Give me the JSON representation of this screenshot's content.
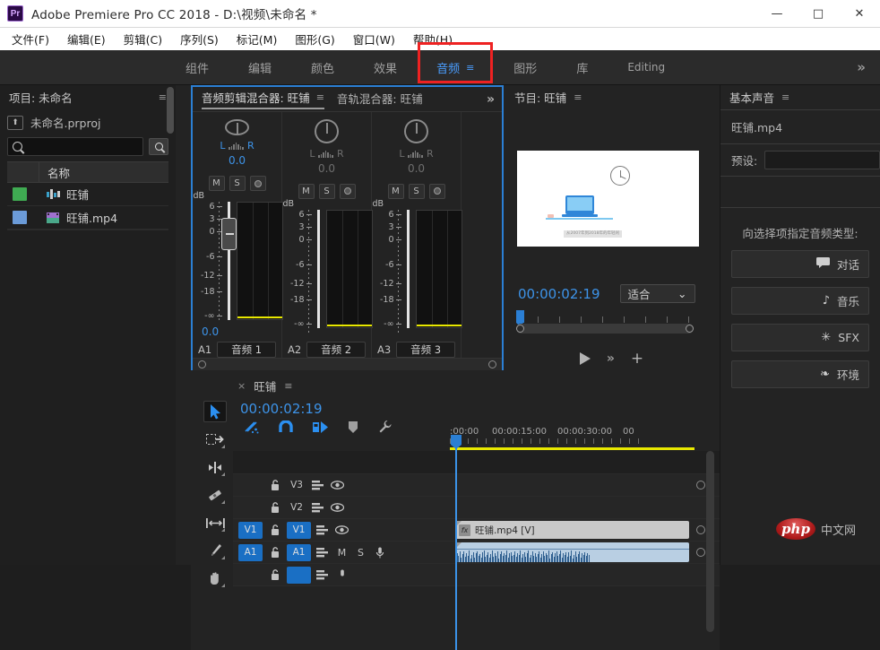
{
  "window": {
    "app_title": "Adobe Premiere Pro CC 2018 - D:\\视频\\未命名 *",
    "logo": "Pr",
    "minimize": "—",
    "maximize": "□",
    "close": "✕"
  },
  "menu": {
    "items": [
      "文件(F)",
      "编辑(E)",
      "剪辑(C)",
      "序列(S)",
      "标记(M)",
      "图形(G)",
      "窗口(W)",
      "帮助(H)"
    ]
  },
  "workspace": {
    "items": [
      {
        "label": "组件",
        "active": false
      },
      {
        "label": "编辑",
        "active": false
      },
      {
        "label": "颜色",
        "active": false
      },
      {
        "label": "效果",
        "active": false
      },
      {
        "label": "音频",
        "active": true
      },
      {
        "label": "图形",
        "active": false
      },
      {
        "label": "库",
        "active": false
      },
      {
        "label": "Editing",
        "active": false
      }
    ],
    "menu_glyph": "≡",
    "overflow": "»",
    "highlight_color": "#ee2222"
  },
  "project": {
    "title": "项目: 未命名",
    "menu_glyph": "≡",
    "file_name": "未命名.prproj",
    "search_placeholder": "",
    "column_header": "名称",
    "items": [
      {
        "label": "旺铺",
        "swatch": "#3fab52",
        "icon": "sequence-icon"
      },
      {
        "label": "旺铺.mp4",
        "swatch": "#6b9bd8",
        "icon": "video-clip-icon"
      }
    ]
  },
  "mixer": {
    "tabs": [
      {
        "label": "音频剪辑混合器: 旺铺",
        "active": true,
        "menu_glyph": "≡"
      },
      {
        "label": "音轨混合器: 旺铺",
        "active": false
      }
    ],
    "overflow": "»",
    "db_label": "dB",
    "db_ticks": [
      "6",
      "3",
      "0",
      "-6",
      "-12",
      "-18",
      "-∞"
    ],
    "strips": [
      {
        "pan_left": "L",
        "pan_right": "R",
        "pan_value": "0.0",
        "mute": "M",
        "solo": "S",
        "volume": "0.0",
        "track_id": "A1",
        "track_name": "音频 1",
        "selected": true
      },
      {
        "pan_left": "L",
        "pan_right": "R",
        "pan_value": "0.0",
        "mute": "M",
        "solo": "S",
        "volume": "",
        "track_id": "A2",
        "track_name": "音频 2",
        "selected": false
      },
      {
        "pan_left": "L",
        "pan_right": "R",
        "pan_value": "0.0",
        "mute": "M",
        "solo": "S",
        "volume": "",
        "track_id": "A3",
        "track_name": "音频 3",
        "selected": false
      }
    ]
  },
  "program": {
    "title": "节目: 旺铺",
    "menu_glyph": "≡",
    "timecode": "00:00:02:19",
    "fit_label": "适合",
    "fit_chevron": "⌄",
    "play_icon": "play-icon",
    "more_icon": "»",
    "add_icon": "+",
    "video_caption": "从2007年到2018年的年轻闲"
  },
  "essential": {
    "title": "基本声音",
    "menu_glyph": "≡",
    "clip_name": "旺铺.mp4",
    "preset_label": "预设:",
    "preset_value": "",
    "assign_label": "向选择项指定音频类型:",
    "types": [
      {
        "label": "对话",
        "icon": "speech-bubble-icon",
        "glyph": "💬"
      },
      {
        "label": "音乐",
        "icon": "music-note-icon",
        "glyph": "♪"
      },
      {
        "label": "SFX",
        "icon": "sparkle-icon",
        "glyph": "✳"
      },
      {
        "label": "环境",
        "icon": "leaf-icon",
        "glyph": "❧"
      }
    ]
  },
  "timeline": {
    "tab_label": "旺铺",
    "close_glyph": "×",
    "menu_glyph": "≡",
    "timecode": "00:00:02:19",
    "toolbar_icons": [
      "sync-lock-icon",
      "snap-magnet-icon",
      "linked-selection-icon",
      "marker-icon",
      "settings-wrench-icon"
    ],
    "ruler_labels": [
      ":00:00",
      "00:00:15:00",
      "00:00:30:00",
      "00"
    ],
    "tools": [
      {
        "name": "selection-tool",
        "active": true
      },
      {
        "name": "track-select-forward-tool",
        "active": false
      },
      {
        "name": "ripple-edit-tool",
        "active": false
      },
      {
        "name": "razor-tool",
        "active": false
      },
      {
        "name": "slip-tool",
        "active": false
      },
      {
        "name": "pen-tool",
        "active": false
      },
      {
        "name": "hand-tool",
        "active": false
      }
    ],
    "tracks": [
      {
        "id": "V3",
        "target": "",
        "targeted": false,
        "lock": "lock-icon",
        "eye": "eye-icon",
        "type": "video"
      },
      {
        "id": "V2",
        "target": "",
        "targeted": false,
        "lock": "lock-icon",
        "eye": "eye-icon",
        "type": "video"
      },
      {
        "id": "V1",
        "target": "V1",
        "targeted": true,
        "lock": "lock-icon",
        "eye": "eye-icon",
        "type": "video",
        "clip": "旺铺.mp4 [V]"
      },
      {
        "id": "A1",
        "target": "A1",
        "targeted": true,
        "lock": "lock-icon",
        "mute": "M",
        "solo": "S",
        "mic": "mic-icon",
        "type": "audio",
        "clip": ""
      }
    ]
  },
  "watermark": {
    "logo_text": "php",
    "label": "中文网"
  }
}
